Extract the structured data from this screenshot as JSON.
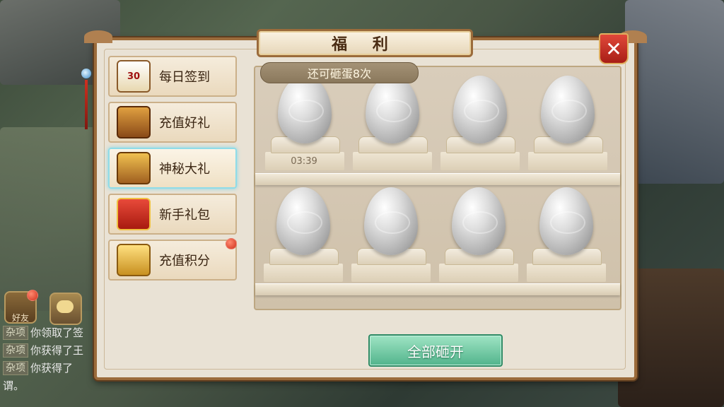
{
  "panel": {
    "title": "福 利",
    "close_label": "✕",
    "accent_color": "#9b6b3b"
  },
  "tabs": [
    {
      "label": "每日签到",
      "icon": "calendar-check-icon",
      "icon_text": "30"
    },
    {
      "label": "充值好礼",
      "icon": "treasure-chest-icon"
    },
    {
      "label": "神秘大礼",
      "icon": "golden-chest-icon",
      "active": true
    },
    {
      "label": "新手礼包",
      "icon": "gift-box-icon"
    },
    {
      "label": "充值积分",
      "icon": "gold-pile-icon",
      "badge": true
    }
  ],
  "eggs": {
    "remaining_text": "还可砸蛋8次",
    "count": 8,
    "timer": "03:39"
  },
  "actions": {
    "smash_all_label": "全部砸开"
  },
  "chat": {
    "friend_label": "好友",
    "lines": [
      {
        "tag": "杂项",
        "text": "你领取了签"
      },
      {
        "tag": "杂项",
        "text": "你获得了王"
      },
      {
        "tag": "杂项",
        "text": "你获得了"
      }
    ],
    "tail": "谓。"
  }
}
